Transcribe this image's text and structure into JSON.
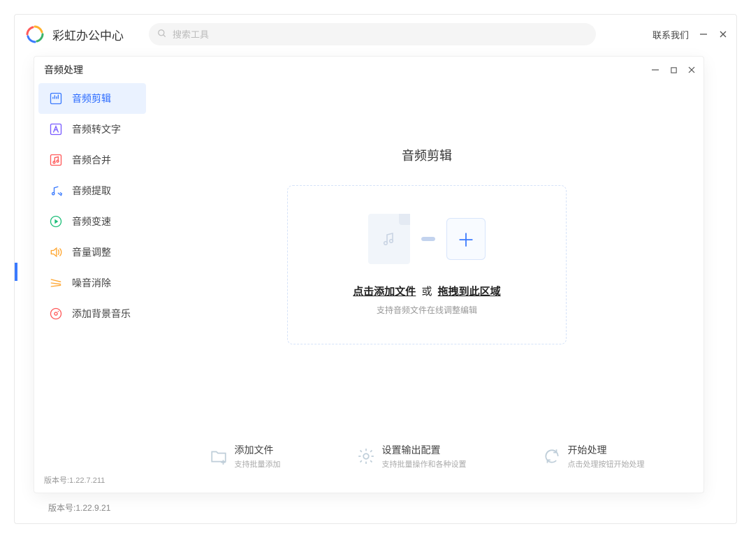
{
  "main": {
    "app_title": "彩虹办公中心",
    "search_placeholder": "搜索工具",
    "contact_label": "联系我们",
    "version_label": "版本号:1.22.9.21"
  },
  "modal": {
    "title": "音频处理",
    "version_label": "版本号:1.22.7.211",
    "sidebar": [
      {
        "key": "audio-trim",
        "label": "音频剪辑",
        "icon": "waveform-icon",
        "active": true,
        "color": "#3a7afe"
      },
      {
        "key": "audio-to-text",
        "label": "音频转文字",
        "icon": "letter-a-icon",
        "active": false,
        "color": "#7a5cff"
      },
      {
        "key": "audio-merge",
        "label": "音频合并",
        "icon": "music-note-icon",
        "active": false,
        "color": "#ff5a5a"
      },
      {
        "key": "audio-extract",
        "label": "音频提取",
        "icon": "music-extract-icon",
        "active": false,
        "color": "#3a7afe"
      },
      {
        "key": "audio-speed",
        "label": "音频变速",
        "icon": "play-circle-icon",
        "active": false,
        "color": "#1fbf7a"
      },
      {
        "key": "volume-adjust",
        "label": "音量调整",
        "icon": "speaker-icon",
        "active": false,
        "color": "#ffa52e"
      },
      {
        "key": "noise-remove",
        "label": "噪音消除",
        "icon": "noise-lines-icon",
        "active": false,
        "color": "#ffa52e"
      },
      {
        "key": "add-bgm",
        "label": "添加背景音乐",
        "icon": "disc-icon",
        "active": false,
        "color": "#ff5a5a"
      }
    ],
    "content": {
      "title": "音频剪辑",
      "dropzone": {
        "click_label": "点击添加文件",
        "separator": "或",
        "drag_label": "拖拽到此区域",
        "subtitle": "支持音频文件在线调整编辑"
      }
    },
    "footer": {
      "add": {
        "title": "添加文件",
        "subtitle": "支持批量添加"
      },
      "config": {
        "title": "设置输出配置",
        "subtitle": "支持批量操作和各种设置"
      },
      "start": {
        "title": "开始处理",
        "subtitle": "点击处理按钮开始处理"
      }
    }
  },
  "icons": {
    "plus": "＋"
  }
}
